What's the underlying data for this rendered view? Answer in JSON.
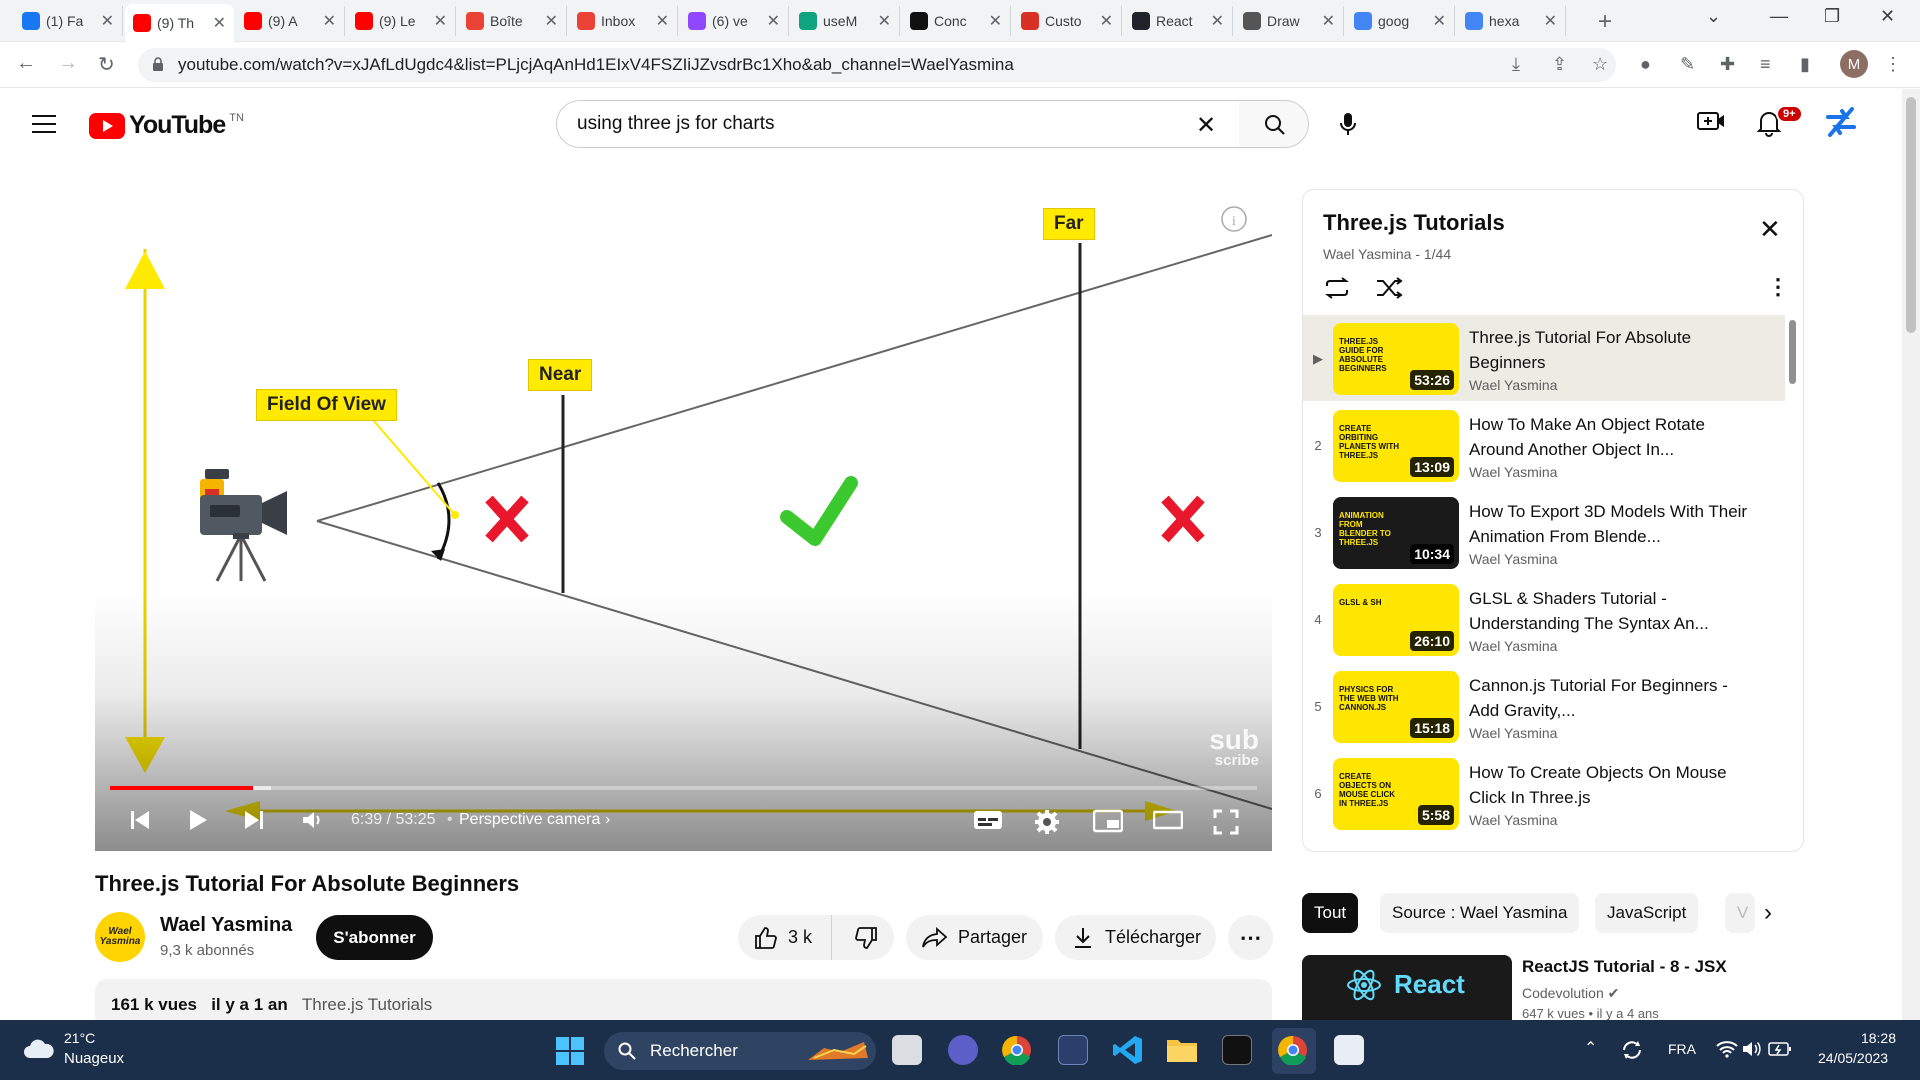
{
  "browser": {
    "tabs": [
      {
        "label": "(1) Fa",
        "icon": "facebook-icon",
        "color": "#1877f2"
      },
      {
        "label": "(9) Th",
        "icon": "youtube-icon",
        "color": "#ff0000",
        "active": true
      },
      {
        "label": "(9) A",
        "icon": "youtube-icon",
        "color": "#ff0000"
      },
      {
        "label": "(9) Le",
        "icon": "youtube-icon",
        "color": "#ff0000"
      },
      {
        "label": "Boîte",
        "icon": "gmail-icon",
        "color": "#ea4335"
      },
      {
        "label": "Inbox",
        "icon": "gmail-icon",
        "color": "#ea4335"
      },
      {
        "label": "(6) ve",
        "icon": "twitch-icon",
        "color": "#9146ff"
      },
      {
        "label": "useM",
        "icon": "chatgpt-icon",
        "color": "#10a37f"
      },
      {
        "label": "Conc",
        "icon": "medium-icon",
        "color": "#111111"
      },
      {
        "label": "Custo",
        "icon": "tool-icon",
        "color": "#d93025"
      },
      {
        "label": "React",
        "icon": "react-icon",
        "color": "#20232a"
      },
      {
        "label": "Draw",
        "icon": "draw-icon",
        "color": "#555555"
      },
      {
        "label": "goog",
        "icon": "google-icon",
        "color": "#4285f4"
      },
      {
        "label": "hexa",
        "icon": "google-icon",
        "color": "#4285f4"
      }
    ],
    "url": "youtube.com/watch?v=xJAfLdUgdc4&list=PLjcjAqAnHd1EIxV4FSZIiJZvsdrBc1Xho&ab_channel=WaelYasmina",
    "profile_initial": "M"
  },
  "header": {
    "logo_text": "YouTube",
    "country_code": "TN",
    "search_value": "using three js for charts",
    "notification_count": "9+"
  },
  "player": {
    "labels": {
      "fov": "Field Of View",
      "near": "Near",
      "far": "Far"
    },
    "watermark_top": "sub",
    "watermark_bottom": "scribe",
    "current_time": "6:39",
    "duration": "53:25",
    "time_text": "6:39 / 53:25",
    "chapter": "Perspective camera",
    "progress_fraction": 0.1245,
    "buffer_fraction": 0.14
  },
  "video": {
    "title": "Three.js Tutorial For Absolute Beginners",
    "channel": "Wael Yasmina",
    "subscribers": "9,3 k abonnés",
    "subscribe_label": "S'abonner",
    "likes": "3 k",
    "share_label": "Partager",
    "download_label": "Télécharger",
    "views": "161 k vues",
    "age": "il y a 1 an",
    "playlist_link": "Three.js Tutorials",
    "avatar_text": "Wael Yasmina"
  },
  "playlist": {
    "title": "Three.js Tutorials",
    "meta": "Wael Yasmina - 1/44",
    "items": [
      {
        "index": "▶",
        "title": "Three.js Tutorial For Absolute Beginners",
        "channel": "Wael Yasmina",
        "duration": "53:26",
        "thumb_text": "THREE.JS GUIDE FOR ABSOLUTE BEGINNERS",
        "active": true
      },
      {
        "index": "2",
        "title": "How To Make An Object Rotate Around Another Object In...",
        "channel": "Wael Yasmina",
        "duration": "13:09",
        "thumb_text": "CREATE ORBITING PLANETS WITH THREE.JS"
      },
      {
        "index": "3",
        "title": "How To Export 3D Models With Their Animation From Blende...",
        "channel": "Wael Yasmina",
        "duration": "10:34",
        "thumb_text": "ANIMATION FROM BLENDER TO THREE.JS"
      },
      {
        "index": "4",
        "title": "GLSL & Shaders Tutorial - Understanding The Syntax An...",
        "channel": "Wael Yasmina",
        "duration": "26:10",
        "thumb_text": "GLSL & SH"
      },
      {
        "index": "5",
        "title": "Cannon.js Tutorial For Beginners - Add Gravity,...",
        "channel": "Wael Yasmina",
        "duration": "15:18",
        "thumb_text": "PHYSICS FOR THE WEB WITH CANNON.JS"
      },
      {
        "index": "6",
        "title": "How To Create Objects On Mouse Click In Three.js",
        "channel": "Wael Yasmina",
        "duration": "5:58",
        "thumb_text": "CREATE OBJECTS ON MOUSE CLICK IN THREE.JS"
      }
    ]
  },
  "chips": [
    "Tout",
    "Source : Wael Yasmina",
    "JavaScript",
    "V"
  ],
  "recommendation": {
    "thumb_text": "React",
    "title": "ReactJS Tutorial - 8 - JSX",
    "channel": "Codevolution",
    "meta": "647 k vues • il y a 4 ans"
  },
  "taskbar": {
    "temperature": "21°C",
    "weather": "Nuageux",
    "search_placeholder": "Rechercher",
    "language": "FRA",
    "time": "18:28",
    "date": "24/05/2023"
  },
  "colors": {
    "accent_red": "#ff0000",
    "label_yellow": "#ffea00",
    "taskbar_bg": "#1c2f4a"
  }
}
